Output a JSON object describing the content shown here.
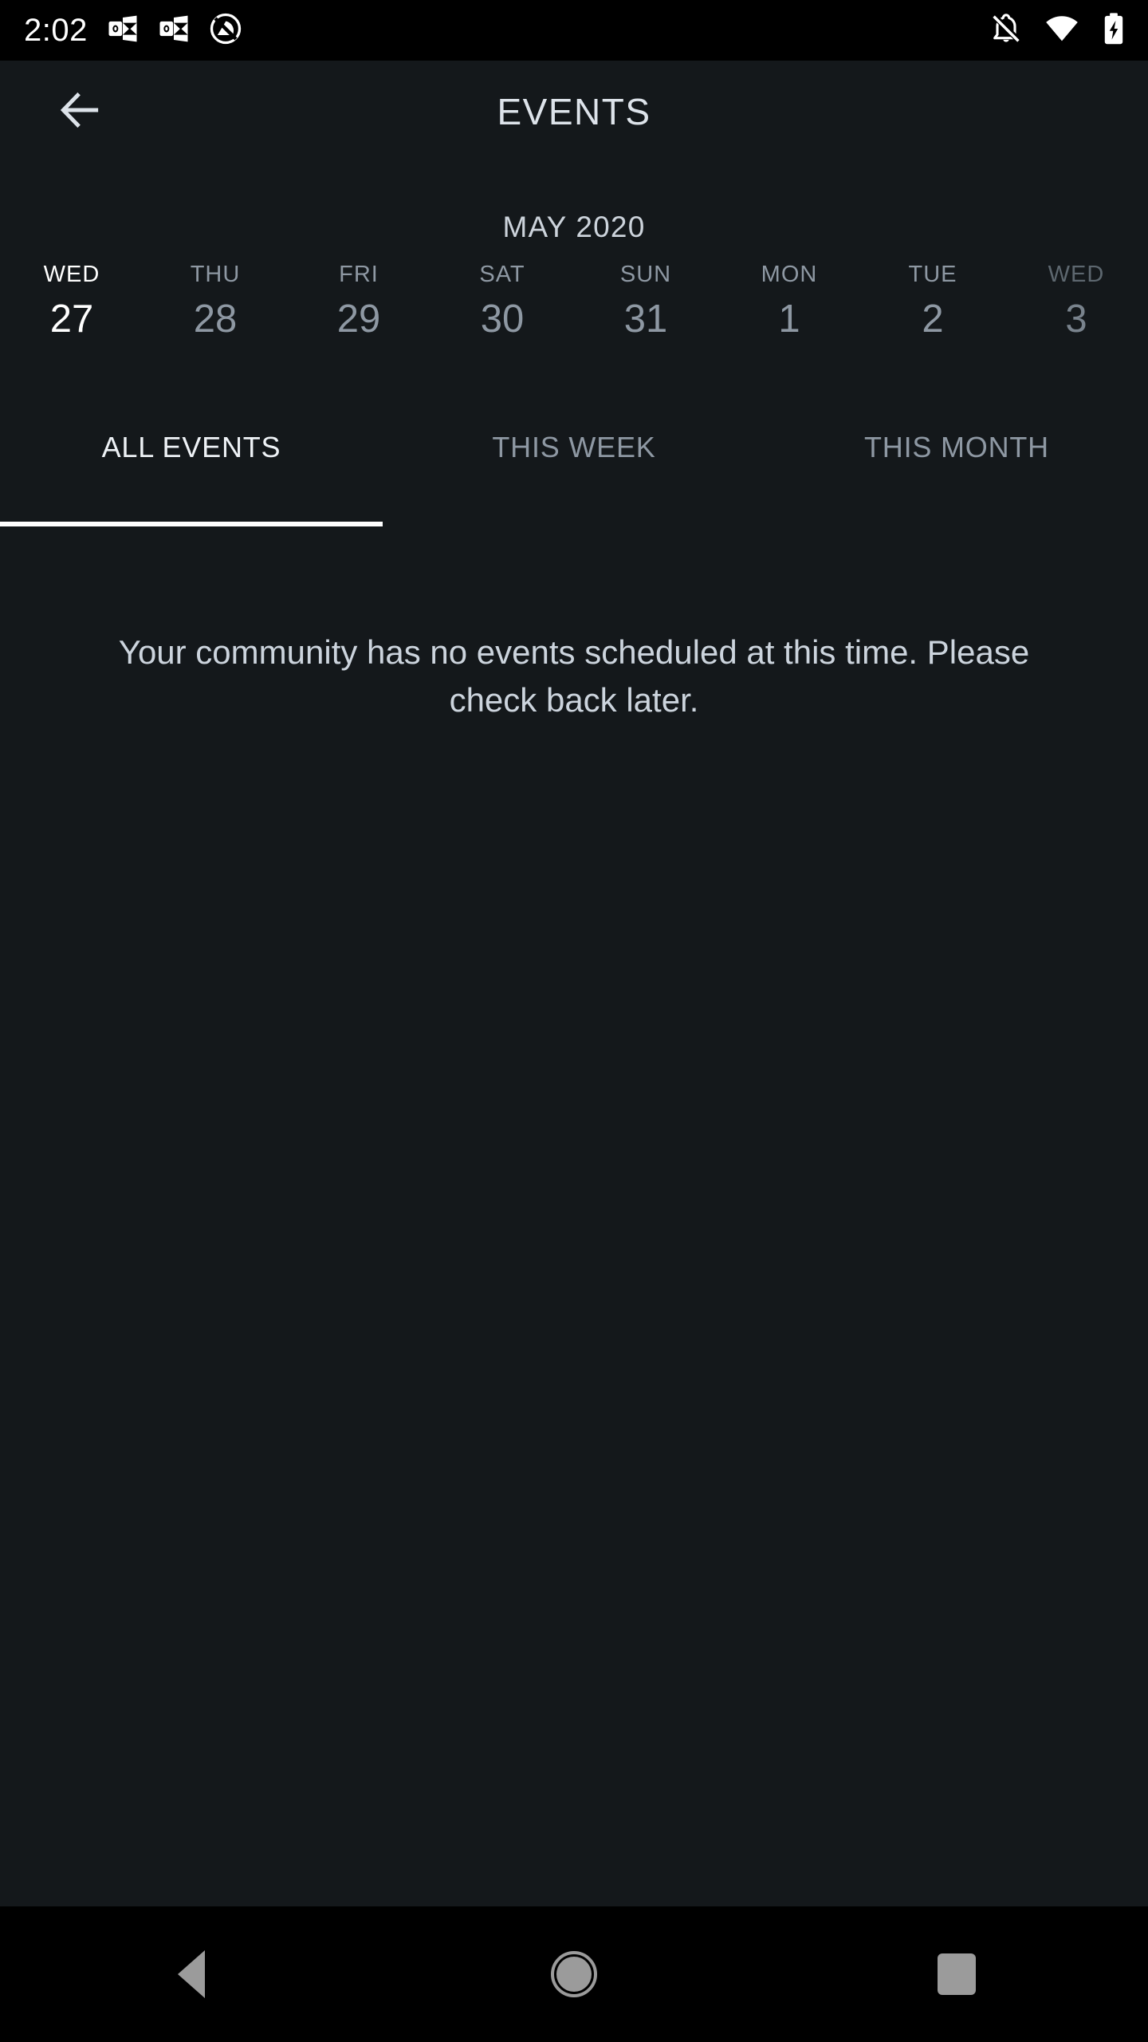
{
  "status_bar": {
    "time": "2:02",
    "left_icons": [
      "outlook-mail-icon",
      "outlook-mail-icon",
      "circle-slash-icon"
    ],
    "right_icons": [
      "bell-off-icon",
      "wifi-icon",
      "battery-charging-icon"
    ],
    "background_color": "#000000"
  },
  "header": {
    "back_icon": "arrow-left-icon",
    "title": "EVENTS"
  },
  "calendar": {
    "month_label": "MAY 2020",
    "days": [
      {
        "name": "WED",
        "number": "27",
        "state": "selected"
      },
      {
        "name": "THU",
        "number": "28",
        "state": "normal"
      },
      {
        "name": "FRI",
        "number": "29",
        "state": "normal"
      },
      {
        "name": "SAT",
        "number": "30",
        "state": "normal"
      },
      {
        "name": "SUN",
        "number": "31",
        "state": "normal"
      },
      {
        "name": "MON",
        "number": "1",
        "state": "normal"
      },
      {
        "name": "TUE",
        "number": "2",
        "state": "normal"
      },
      {
        "name": "WED",
        "number": "3",
        "state": "faded"
      }
    ]
  },
  "tabs": [
    {
      "label": "ALL EVENTS",
      "active": true
    },
    {
      "label": "THIS WEEK",
      "active": false
    },
    {
      "label": "THIS MONTH",
      "active": false
    }
  ],
  "content": {
    "empty_message": "Your community has no events scheduled at this time. Please check back later."
  },
  "nav_bar": {
    "back": "nav-back-icon",
    "home": "nav-home-icon",
    "recents": "nav-recents-icon"
  },
  "colors": {
    "app_background": "#14181b",
    "system_background": "#000000",
    "primary_text": "#eef2f6",
    "secondary_text": "#8e98a3",
    "accent_indicator": "#ffffff",
    "nav_icon": "#9b9b9b"
  }
}
